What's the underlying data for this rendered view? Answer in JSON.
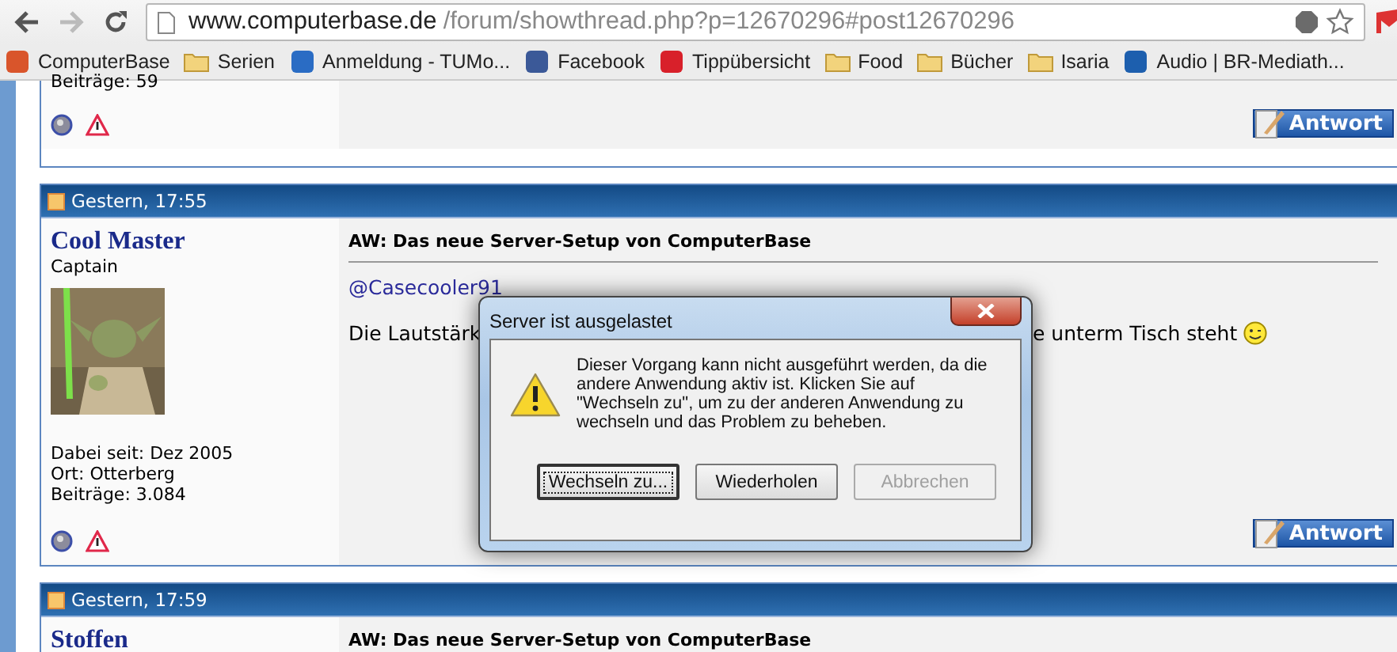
{
  "browser": {
    "back_disabled": false,
    "forward_disabled": true,
    "url_host": "www.computerbase.de",
    "url_path": "/forum/showthread.php?p=12670296#post12670296",
    "bookmarks": [
      {
        "label": "ComputerBase",
        "kind": "site",
        "color": "#d9552b"
      },
      {
        "label": "Serien",
        "kind": "folder"
      },
      {
        "label": "Anmeldung - TUMo...",
        "kind": "site",
        "color": "#2a6cc4"
      },
      {
        "label": "Facebook",
        "kind": "site",
        "color": "#3b5998"
      },
      {
        "label": "Tippübersicht",
        "kind": "site",
        "color": "#d8202a"
      },
      {
        "label": "Food",
        "kind": "folder"
      },
      {
        "label": "Bücher",
        "kind": "folder"
      },
      {
        "label": "Isaria",
        "kind": "folder"
      },
      {
        "label": "Audio | BR-Mediath...",
        "kind": "site",
        "color": "#1d5fae"
      }
    ]
  },
  "posts": [
    {
      "user_lines": [
        "Beiträge: 59"
      ],
      "reply_button": "Antwort"
    },
    {
      "date": "Gestern, 17:55",
      "username": "Cool Master",
      "rank": "Captain",
      "user_lines": [
        "Dabei seit: Dez 2005",
        "Ort: Otterberg",
        "Beiträge: 3.084"
      ],
      "title": "AW: Das neue Server-Setup von ComputerBase",
      "mention": "@Casecooler91",
      "text_before": "Die Lautstärk",
      "text_after": "e unterm Tisch steht",
      "reply_button": "Antwort"
    },
    {
      "date": "Gestern, 17:59",
      "username": "Stoffen",
      "title": "AW: Das neue Server-Setup von ComputerBase"
    }
  ],
  "dialog": {
    "title": "Server ist ausgelastet",
    "message": "Dieser Vorgang kann nicht ausgeführt werden, da die andere Anwendung aktiv ist. Klicken Sie auf \"Wechseln zu\", um zu der anderen Anwendung zu wechseln und das Problem zu beheben.",
    "buttons": [
      {
        "label": "Wechseln zu...",
        "focused": true,
        "disabled": false
      },
      {
        "label": "Wiederholen",
        "focused": false,
        "disabled": false
      },
      {
        "label": "Abbrechen",
        "focused": false,
        "disabled": true
      }
    ]
  }
}
